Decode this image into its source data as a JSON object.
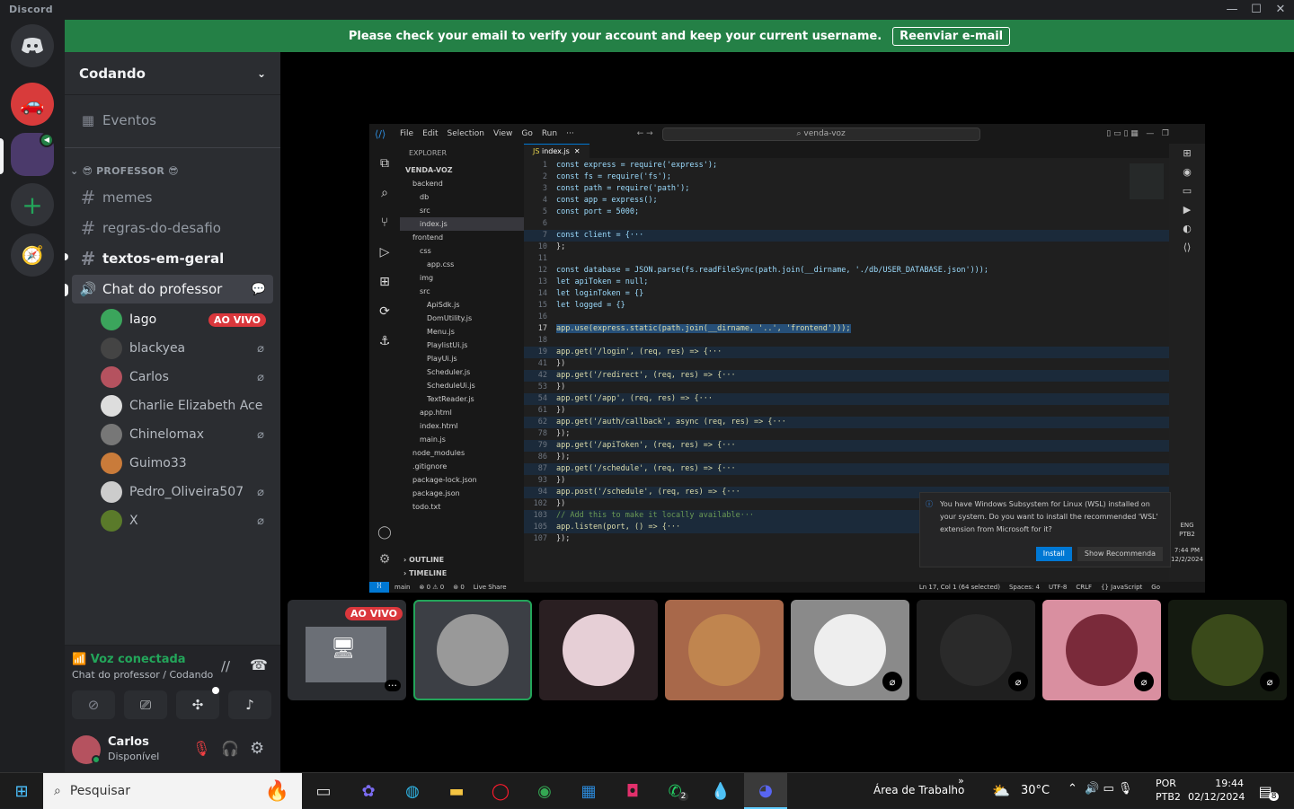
{
  "app_title": "Discord",
  "banner": {
    "message": "Please check your email to verify your account and keep your current username.",
    "button": "Reenviar e-mail"
  },
  "server": {
    "name": "Codando",
    "events_label": "Eventos",
    "category": "😎 PROFESSOR 😎",
    "channels": [
      "memes",
      "regras-do-desafio",
      "textos-em-geral"
    ],
    "voice_channel": "Chat do professor",
    "members": [
      {
        "name": "Iago",
        "badge": "AO VIVO",
        "color": "#3ba55c"
      },
      {
        "name": "blackyea",
        "muted": true,
        "color": "#444"
      },
      {
        "name": "Carlos",
        "muted": true,
        "color": "#b5525f"
      },
      {
        "name": "Charlie Elizabeth Ace",
        "muted": false,
        "color": "#ddd"
      },
      {
        "name": "Chinelomax",
        "muted": true,
        "color": "#777"
      },
      {
        "name": "Guimo33",
        "muted": false,
        "color": "#c97b3a"
      },
      {
        "name": "Pedro_Oliveira507",
        "muted": true,
        "color": "#ccc"
      },
      {
        "name": "X",
        "muted": true,
        "color": "#5a7a2a"
      }
    ]
  },
  "voice": {
    "status": "Voz conectada",
    "location": "Chat do professor / Codando"
  },
  "user": {
    "name": "Carlos",
    "status": "Disponível"
  },
  "stream": {
    "live_badge": "AO VIVO",
    "vscode": {
      "menu": [
        "File",
        "Edit",
        "Selection",
        "View",
        "Go",
        "Run",
        "···"
      ],
      "search": "venda-voz",
      "tab": "index.js",
      "explorer_title": "EXPLORER",
      "tree": [
        "VENDA-VOZ",
        "backend",
        "db",
        "src",
        "index.js",
        "frontend",
        "css",
        "app.css",
        "img",
        "src",
        "ApiSdk.js",
        "DomUtility.js",
        "Menu.js",
        "PlaylistUi.js",
        "PlayUi.js",
        "Scheduler.js",
        "ScheduleUi.js",
        "TextReader.js",
        "app.html",
        "index.html",
        "main.js",
        "node_modules",
        ".gitignore",
        "package-lock.json",
        "package.json",
        "todo.txt"
      ],
      "outline": "OUTLINE",
      "timeline": "TIMELINE",
      "code": [
        {
          "n": "1",
          "t": "const express = require('express');"
        },
        {
          "n": "2",
          "t": "const fs = require('fs');"
        },
        {
          "n": "3",
          "t": "const path = require('path');"
        },
        {
          "n": "4",
          "t": "const app = express();"
        },
        {
          "n": "5",
          "t": "const port = 5000;"
        },
        {
          "n": "6",
          "t": ""
        },
        {
          "n": "7",
          "t": "const client = {···"
        },
        {
          "n": "10",
          "t": "};"
        },
        {
          "n": "11",
          "t": ""
        },
        {
          "n": "12",
          "t": "const database = JSON.parse(fs.readFileSync(path.join(__dirname, './db/USER_DATABASE.json')));"
        },
        {
          "n": "13",
          "t": "let apiToken = null;"
        },
        {
          "n": "14",
          "t": "let loginToken = {}"
        },
        {
          "n": "15",
          "t": "let logged = {}"
        },
        {
          "n": "16",
          "t": ""
        },
        {
          "n": "17",
          "t": "app.use(express.static(path.join(__dirname, '..', 'frontend')));"
        },
        {
          "n": "18",
          "t": ""
        },
        {
          "n": "19",
          "t": "app.get('/login', (req, res) => {···"
        },
        {
          "n": "41",
          "t": "})"
        },
        {
          "n": "42",
          "t": "app.get('/redirect', (req, res) => {···"
        },
        {
          "n": "53",
          "t": "})"
        },
        {
          "n": "54",
          "t": "app.get('/app', (req, res) => {···"
        },
        {
          "n": "61",
          "t": "})"
        },
        {
          "n": "62",
          "t": "app.get('/auth/callback', async (req, res) => {···"
        },
        {
          "n": "78",
          "t": "});"
        },
        {
          "n": "79",
          "t": "app.get('/apiToken', (req, res) => {···"
        },
        {
          "n": "86",
          "t": "});"
        },
        {
          "n": "87",
          "t": "app.get('/schedule', (req, res) => {···"
        },
        {
          "n": "93",
          "t": "})"
        },
        {
          "n": "94",
          "t": "app.post('/schedule', (req, res) => {···"
        },
        {
          "n": "102",
          "t": "})"
        },
        {
          "n": "103",
          "t": "// Add this to make it locally available···"
        },
        {
          "n": "105",
          "t": "app.listen(port, () => {···"
        },
        {
          "n": "107",
          "t": "});"
        }
      ],
      "toast": "You have Windows Subsystem for Linux (WSL) installed on your system. Do you want to install the recommended 'WSL' extension from Microsoft for it?",
      "toast_install": "Install",
      "toast_show": "Show Recommenda",
      "status_left": [
        "main",
        "⊗ 0 ⚠ 0",
        "⊛ 0",
        "Live Share"
      ],
      "status_right": [
        "Ln 17, Col 1 (64 selected)",
        "Spaces: 4",
        "UTF-8",
        "CRLF",
        "{} JavaScript",
        "Go"
      ],
      "tray": {
        "lang": "ENG",
        "layout": "PTB2",
        "time": "7:44 PM",
        "date": "12/2/2024"
      }
    }
  },
  "tiles": [
    {
      "color": "#3c3f45",
      "circle": "#999",
      "muted": false,
      "selected": true
    },
    {
      "color": "#2a1f22",
      "circle": "#e6cfd6",
      "muted": false
    },
    {
      "color": "#a8684a",
      "circle": "#c0854f",
      "muted": false
    },
    {
      "color": "#8a8a8a",
      "circle": "#eee",
      "muted": true
    },
    {
      "color": "#1f1f1f",
      "circle": "#2a2a2a",
      "muted": true
    },
    {
      "color": "#d98fa0",
      "circle": "#7a2a3a",
      "muted": true
    },
    {
      "color": "#141a10",
      "circle": "#3a4a1a",
      "muted": true
    }
  ],
  "taskbar": {
    "search_placeholder": "Pesquisar",
    "desktop_label": "Área de Trabalho",
    "weather": "30°C",
    "lang": "POR",
    "layout": "PTB2",
    "time": "19:44",
    "date": "02/12/2024",
    "whatsapp_badge": "2",
    "notif_badge": "8"
  }
}
